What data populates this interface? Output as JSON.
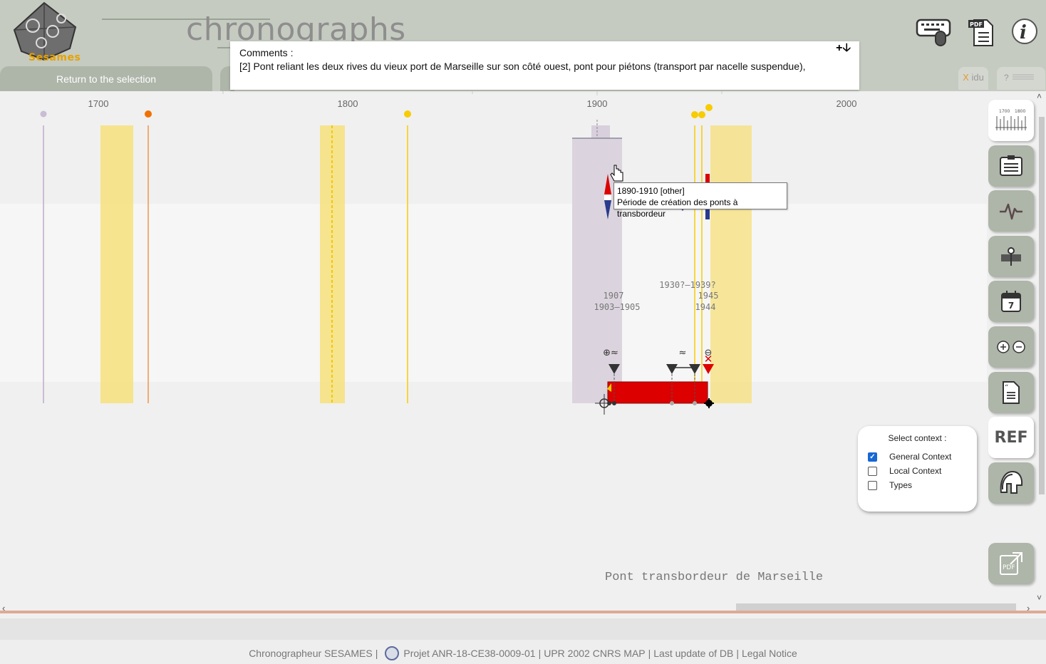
{
  "header": {
    "logo_text": "Sesames",
    "app_title": "chronographs",
    "return_tab": "Return to the selection",
    "idu_tab_x": "X",
    "idu_tab_label": "idu",
    "help_tab": "?",
    "icons": [
      "keyboard-mouse-icon",
      "pdf-document-icon",
      "info-icon"
    ]
  },
  "comments": {
    "label": "Comments :",
    "text": "[2] Pont reliant les deux rives du vieux port de Marseille sur son côté ouest, pont pour piétons (transport par nacelle suspendue),",
    "expand": "+🡣"
  },
  "timeline": {
    "axis_ticks": [
      "1700",
      "1800",
      "1900",
      "2000"
    ],
    "date_labels": [
      "1907",
      "1903–1905",
      "1930?–1939?",
      "1945",
      "1944"
    ],
    "event_marks": [
      "⊕≈",
      "≈",
      "⊖"
    ],
    "colors": {
      "period_band": "#f7e07b",
      "selected_band": "#d8d0dc",
      "construction_bar": "#dc0000",
      "orange_dot": "#f07000",
      "yellow_dot": "#f7cc00",
      "lilac_dot": "#cbbcd4"
    }
  },
  "tooltip": {
    "line1": "1890-1910  [other]",
    "line2": "Période de création des ponts à transbordeur"
  },
  "right_toolbar": {
    "ref_label": "REF",
    "buttons": [
      "timeline-ruler-icon",
      "notepad-icon",
      "heartbeat-icon",
      "layers-icon",
      "calendar-icon",
      "zoom-in-out-icon",
      "quote-document-icon",
      "ref-icon",
      "helmet-icon"
    ],
    "calendar_day": "7",
    "pdf_label": "PDF"
  },
  "context_panel": {
    "title": "Select context :",
    "options": [
      {
        "label": "General Context",
        "checked": true
      },
      {
        "label": "Local Context",
        "checked": false
      },
      {
        "label": "Types",
        "checked": false
      }
    ]
  },
  "site_title": "Pont transbordeur de Marseille",
  "scrollbars": {
    "left_arrow": "‹",
    "right_arrow": "›",
    "up_arrow": "˄",
    "down_arrow": "˅"
  },
  "footer": {
    "item1": "Chronographeur SESAMES",
    "item2": "Projet ANR-18-CE38-0009-01",
    "item3": "UPR 2002 CNRS MAP",
    "item4": "Last update of DB",
    "item5": "Legal Notice"
  }
}
